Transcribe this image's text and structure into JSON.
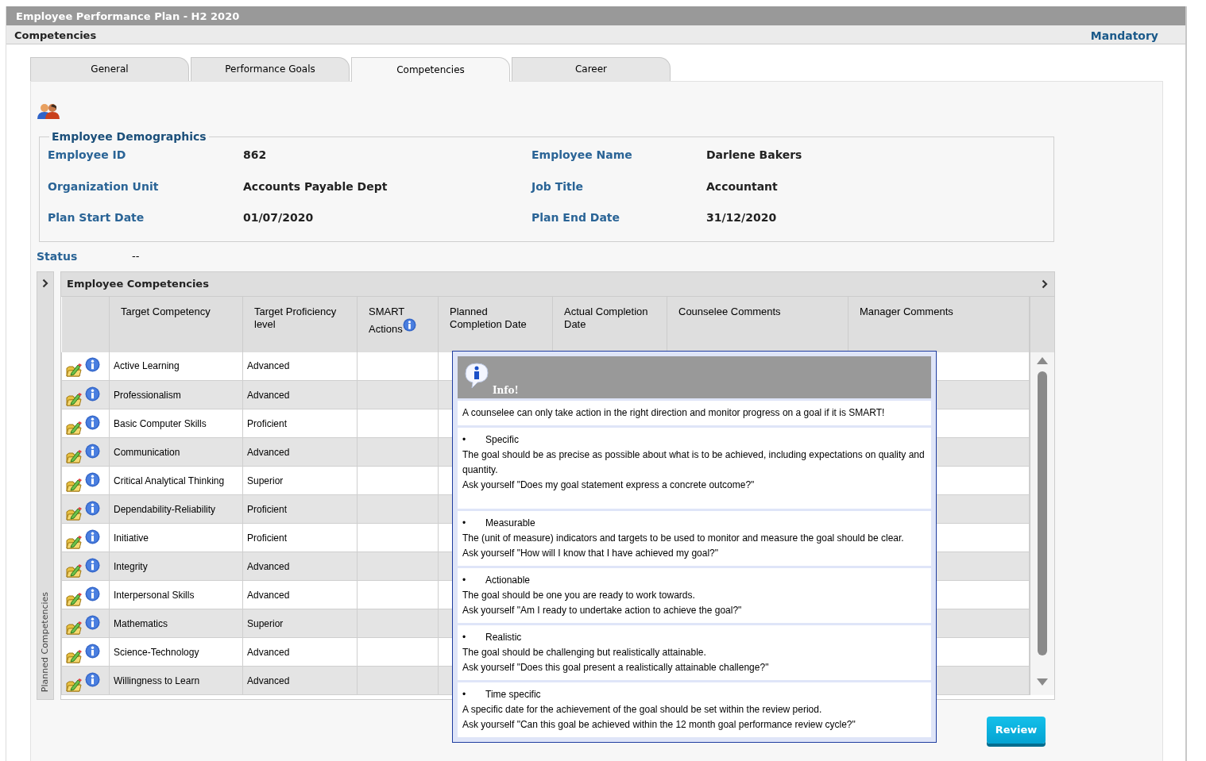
{
  "window": {
    "title": "Employee Performance Plan - H2 2020"
  },
  "header": {
    "section": "Competencies",
    "badge": "Mandatory"
  },
  "tabs": [
    {
      "label": "General",
      "selected": false
    },
    {
      "label": "Performance Goals",
      "selected": false
    },
    {
      "label": "Competencies",
      "selected": true
    },
    {
      "label": "Career",
      "selected": false
    }
  ],
  "demographics": {
    "title": "Employee Demographics",
    "fields": [
      {
        "label": "Employee ID",
        "value": "862"
      },
      {
        "label": "Employee Name",
        "value": "Darlene Bakers"
      },
      {
        "label": "Organization Unit",
        "value": "Accounts Payable Dept"
      },
      {
        "label": "Job Title",
        "value": "Accountant"
      },
      {
        "label": "Plan Start Date",
        "value": "01/07/2020"
      },
      {
        "label": "Plan End Date",
        "value": "31/12/2020"
      }
    ]
  },
  "status": {
    "label": "Status",
    "value": "--"
  },
  "side_panel": {
    "label": "Planned Competencies"
  },
  "competencies": {
    "title": "Employee Competencies",
    "columns": [
      {
        "label": "Target Competency",
        "info": false
      },
      {
        "label": "Target Proficiency level",
        "info": false
      },
      {
        "label": "SMART Actions",
        "info": true
      },
      {
        "label": "Planned Completion Date",
        "info": false
      },
      {
        "label": "Actual Completion Date",
        "info": false
      },
      {
        "label": "Counselee Comments",
        "info": false
      },
      {
        "label": "Manager Comments",
        "info": false
      }
    ],
    "rows": [
      {
        "competency": "Active Learning",
        "level": "Advanced"
      },
      {
        "competency": "Professionalism",
        "level": "Advanced"
      },
      {
        "competency": "Basic Computer Skills",
        "level": "Proficient"
      },
      {
        "competency": "Communication",
        "level": "Advanced"
      },
      {
        "competency": "Critical Analytical Thinking",
        "level": "Superior"
      },
      {
        "competency": "Dependability-Reliability",
        "level": "Proficient"
      },
      {
        "competency": "Initiative",
        "level": "Proficient"
      },
      {
        "competency": "Integrity",
        "level": "Advanced"
      },
      {
        "competency": "Interpersonal Skills",
        "level": "Advanced"
      },
      {
        "competency": "Mathematics",
        "level": "Superior"
      },
      {
        "competency": "Science-Technology",
        "level": "Advanced"
      },
      {
        "competency": "Willingness to Learn",
        "level": "Advanced"
      }
    ]
  },
  "info_popup": {
    "title": "Info!",
    "intro": "A counselee can only take action in the right direction and monitor progress on a goal if it is SMART!",
    "sections": [
      {
        "bullet": "•",
        "heading": "Specific",
        "lines": [
          "The goal should be as precise as possible about what is to be achieved, including expectations on quality and quantity.",
          "Ask yourself \"Does my goal statement express a concrete outcome?\""
        ]
      },
      {
        "bullet": "•",
        "heading": "Measurable",
        "lines": [
          "The (unit of measure) indicators and targets to be used to monitor and measure the goal should be clear.",
          "Ask yourself \"How will I know that I have achieved my goal?\""
        ]
      },
      {
        "bullet": "•",
        "heading": "Actionable",
        "lines": [
          "The goal should be one you are ready to work towards.",
          "Ask yourself \"Am I ready to undertake action to achieve the goal?\""
        ]
      },
      {
        "bullet": "•",
        "heading": "Realistic",
        "lines": [
          "The goal should be challenging but realistically attainable.",
          "Ask yourself \"Does this goal present a realistically attainable challenge?\""
        ]
      },
      {
        "bullet": "•",
        "heading": "Time specific",
        "lines": [
          "A specific date for the achievement of the goal should be set within the review period.",
          "Ask yourself \"Can this goal be achieved within the 12 month goal performance review cycle?\""
        ]
      }
    ]
  },
  "buttons": [
    {
      "label": "Review"
    }
  ]
}
